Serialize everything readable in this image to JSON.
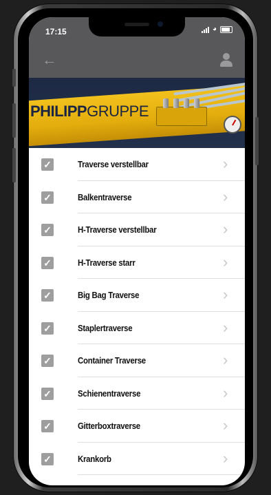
{
  "status_bar": {
    "time": "17:15"
  },
  "nav": {
    "back_icon": "back-arrow-icon",
    "profile_icon": "user-icon"
  },
  "banner": {
    "logo_bold": "PHILIPP",
    "logo_light": "GRUPPE"
  },
  "list": {
    "items": [
      {
        "label": "Traverse verstellbar",
        "checked": true
      },
      {
        "label": "Balkentraverse",
        "checked": true
      },
      {
        "label": "H-Traverse verstellbar",
        "checked": true
      },
      {
        "label": "H-Traverse starr",
        "checked": true
      },
      {
        "label": "Big Bag Traverse",
        "checked": true
      },
      {
        "label": "Staplertraverse",
        "checked": true
      },
      {
        "label": "Container Traverse",
        "checked": true
      },
      {
        "label": "Schienentraverse",
        "checked": true
      },
      {
        "label": "Gitterboxtraverse",
        "checked": true
      },
      {
        "label": "Krankorb",
        "checked": true
      }
    ]
  },
  "colors": {
    "header": "#58585a",
    "checkbox": "#9e9e9e",
    "brand_yellow": "#f2c11c",
    "brand_navy": "#1b2440"
  }
}
